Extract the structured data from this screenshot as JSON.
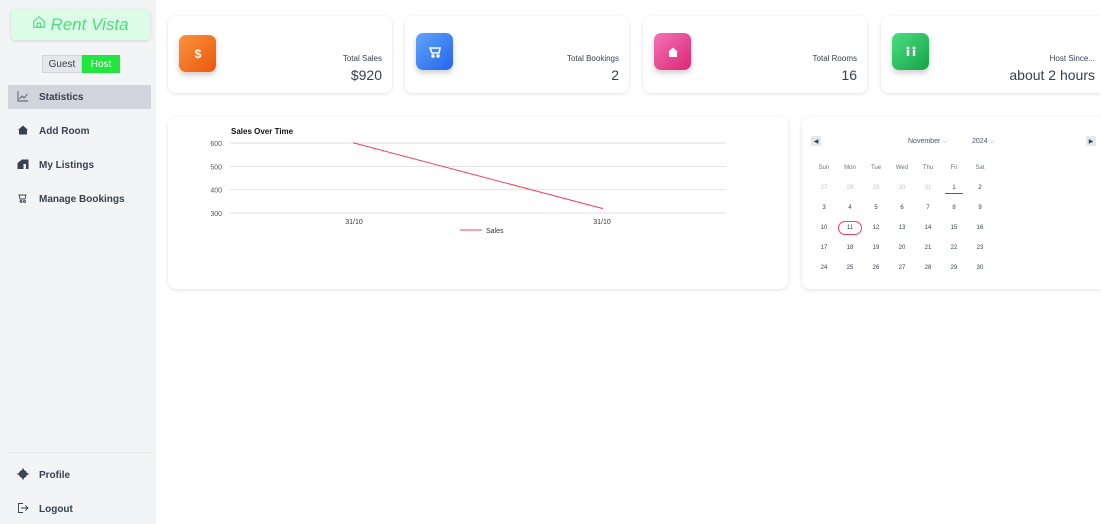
{
  "app": {
    "logo_text": "Rent Vista",
    "logo_icon": "house-icon"
  },
  "role_toggle": {
    "guest_label": "Guest",
    "host_label": "Host",
    "selected": "Host"
  },
  "sidebar": {
    "items": [
      {
        "label": "Statistics",
        "icon": "chart-icon",
        "active": true
      },
      {
        "label": "Add Room",
        "icon": "home-add-icon",
        "active": false
      },
      {
        "label": "My Listings",
        "icon": "listings-icon",
        "active": false
      },
      {
        "label": "Manage Bookings",
        "icon": "bookings-icon",
        "active": false
      }
    ],
    "bottom": [
      {
        "label": "Profile",
        "icon": "gear-icon"
      },
      {
        "label": "Logout",
        "icon": "logout-icon"
      }
    ]
  },
  "stats": [
    {
      "label": "Total Sales",
      "value": "$920",
      "icon": "dollar-icon",
      "color_from": "#fb923c",
      "color_to": "#ea580c"
    },
    {
      "label": "Total Bookings",
      "value": "2",
      "icon": "cart-icon",
      "color_from": "#60a5fa",
      "color_to": "#2563eb"
    },
    {
      "label": "Total Rooms",
      "value": "16",
      "icon": "home-icon",
      "color_from": "#f472b6",
      "color_to": "#db2777"
    },
    {
      "label": "Host Since...",
      "value": "about 2 hours",
      "icon": "host-icon",
      "color_from": "#4ade80",
      "color_to": "#16a34a"
    }
  ],
  "chart_data": {
    "type": "line",
    "title": "Sales Over Time",
    "categories": [
      "31/10",
      "31/10"
    ],
    "series": [
      {
        "name": "Sales",
        "values": [
          600,
          320
        ],
        "color": "#f43f5e"
      }
    ],
    "yticks": [
      300,
      400,
      500,
      600
    ],
    "ylim": [
      300,
      600
    ],
    "legend": "bottom",
    "grid": true
  },
  "calendar": {
    "month": "November",
    "year": "2024",
    "prev_icon": "chevron-left-icon",
    "next_icon": "chevron-right-icon",
    "weekdays": [
      "Sun",
      "Mon",
      "Tue",
      "Wed",
      "Thu",
      "Fri",
      "Sat"
    ],
    "weeks": [
      [
        "27",
        "28",
        "29",
        "30",
        "31",
        "1",
        "2"
      ],
      [
        "3",
        "4",
        "5",
        "6",
        "7",
        "8",
        "9"
      ],
      [
        "10",
        "11",
        "12",
        "13",
        "14",
        "15",
        "16"
      ],
      [
        "17",
        "18",
        "19",
        "20",
        "21",
        "22",
        "23"
      ],
      [
        "24",
        "25",
        "26",
        "27",
        "28",
        "29",
        "30"
      ]
    ],
    "today": "1",
    "selected": "11",
    "accent": "#2563eb",
    "selected_color": "#f43f5e"
  }
}
